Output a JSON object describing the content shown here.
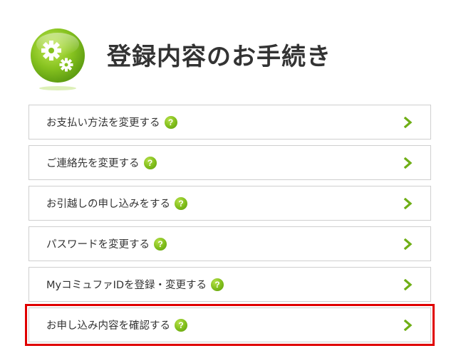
{
  "header": {
    "title": "登録内容のお手続き",
    "icon": "gears-icon"
  },
  "menu": {
    "items": [
      {
        "label": "お支払い方法を変更する",
        "help_icon": "?",
        "highlighted": false
      },
      {
        "label": "ご連絡先を変更する",
        "help_icon": "?",
        "highlighted": false
      },
      {
        "label": "お引越しの申し込みをする",
        "help_icon": "?",
        "highlighted": false
      },
      {
        "label": "パスワードを変更する",
        "help_icon": "?",
        "highlighted": false
      },
      {
        "label": "MyコミュファIDを登録・変更する",
        "help_icon": "?",
        "highlighted": false
      },
      {
        "label": "お申し込み内容を確認する",
        "help_icon": "?",
        "highlighted": true
      }
    ]
  },
  "colors": {
    "accent_green": "#7fbd1a",
    "highlight_red": "#e00000",
    "border": "#cfcfcf",
    "text": "#333333"
  }
}
